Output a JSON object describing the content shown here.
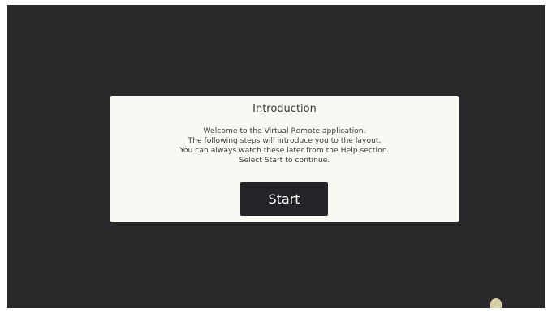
{
  "dialog": {
    "title": "Introduction",
    "lines": [
      "Welcome to the Virtual Remote application.",
      "The following steps will introduce you to the layout.",
      "You can always watch these later from the Help section.",
      "Select Start to continue."
    ],
    "start_label": "Start"
  },
  "colors": {
    "background": "#2a282b",
    "dialog": "#faf8f2",
    "button": "#252327",
    "indicator": "#d6cfa6"
  },
  "icons": {
    "corner": "half-circle-indicator-icon"
  }
}
